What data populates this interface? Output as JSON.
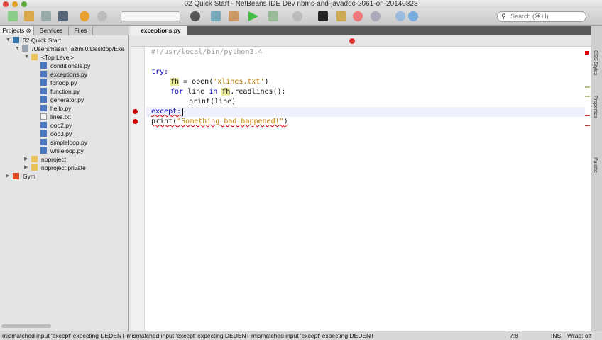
{
  "window": {
    "title": "02 Quick Start - NetBeans IDE Dev nbms-and-javadoc-2061-on-20140828"
  },
  "toolbar": {
    "search_placeholder": "Search (⌘+I)"
  },
  "left_panel": {
    "tabs": [
      {
        "label": "Projects"
      },
      {
        "label": "Services"
      },
      {
        "label": "Files"
      }
    ],
    "tree": [
      {
        "label": "02 Quick Start",
        "icon": "python-project-icon",
        "level": 0,
        "expanded": true
      },
      {
        "label": "/Users/hasan_azimi0/Desktop/Exe",
        "icon": "folder-icon",
        "level": 1,
        "expanded": true
      },
      {
        "label": "<Top Level>",
        "icon": "package-icon",
        "level": 2,
        "expanded": true
      },
      {
        "label": "conditionals.py",
        "icon": "python-file-icon",
        "level": 3
      },
      {
        "label": "exceptions.py",
        "icon": "python-file-icon",
        "level": 3,
        "selected": true
      },
      {
        "label": "forloop.py",
        "icon": "python-file-icon",
        "level": 3
      },
      {
        "label": "function.py",
        "icon": "python-file-icon",
        "level": 3
      },
      {
        "label": "generator.py",
        "icon": "python-file-icon",
        "level": 3
      },
      {
        "label": "hello.py",
        "icon": "python-file-icon",
        "level": 3
      },
      {
        "label": "lines.txt",
        "icon": "text-file-icon",
        "level": 3
      },
      {
        "label": "oop2.py",
        "icon": "python-file-icon",
        "level": 3
      },
      {
        "label": "oop3.py",
        "icon": "python-file-icon",
        "level": 3
      },
      {
        "label": "simpleloop.py",
        "icon": "python-file-icon",
        "level": 3
      },
      {
        "label": "whileloop.py",
        "icon": "python-file-icon",
        "level": 3
      },
      {
        "label": "nbproject",
        "icon": "package-icon",
        "level": 2,
        "expanded": false
      },
      {
        "label": "nbproject.private",
        "icon": "package-icon",
        "level": 2,
        "expanded": false
      },
      {
        "label": "Gym",
        "icon": "html5-project-icon",
        "level": 0,
        "expanded": false
      }
    ]
  },
  "editor": {
    "tab": "exceptions.py",
    "code": {
      "l1": "#!/usr/local/bin/python3.4",
      "l3": "try:",
      "l4_var": "fh",
      "l4_rest": " = open(",
      "l4_str": "'xlines.txt'",
      "l4_end": ")",
      "l5_kw": "for",
      "l5_a": " line ",
      "l5_in": "in",
      "l5_b": " ",
      "l5_var": "fh",
      "l5_c": ".readlines():",
      "l6": "print(line)",
      "l7": "except:",
      "l8_a": "print(",
      "l8_str": "\"Something bad happened!\"",
      "l8_b": ")"
    }
  },
  "right_panel": {
    "tabs": [
      {
        "label": "CSS Styles"
      },
      {
        "label": "Properties"
      },
      {
        "label": "Palette"
      }
    ]
  },
  "status": {
    "message": "mismatched input 'except' expecting DEDENT  mismatched input 'except' expecting DEDENT  mismatched input 'except' expecting DEDENT",
    "position": "7:8",
    "mode": "INS",
    "wrap": "Wrap: off"
  },
  "colors": {
    "keyword": "#0000c0",
    "string": "#c27a00",
    "error": "#cc0000"
  }
}
